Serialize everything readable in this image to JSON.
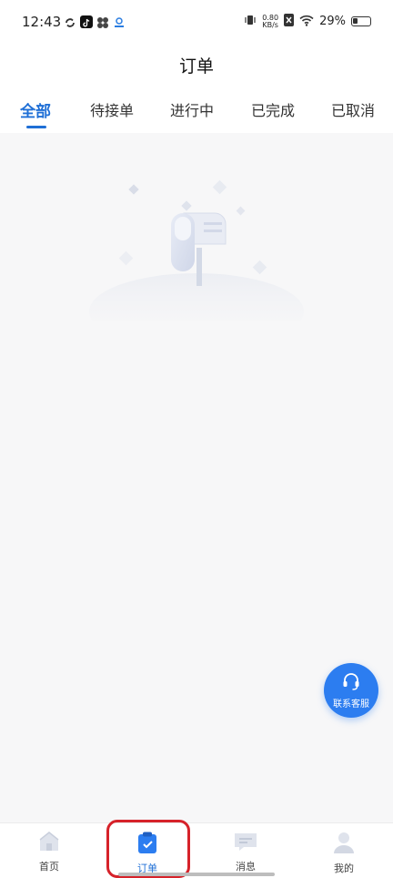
{
  "status_bar": {
    "time": "12:43",
    "net_speed_value": "0.80",
    "net_speed_unit": "KB/s",
    "battery_percent": "29%"
  },
  "header": {
    "title": "订单"
  },
  "tabs": [
    {
      "label": "全部",
      "active": true
    },
    {
      "label": "待接单",
      "active": false
    },
    {
      "label": "进行中",
      "active": false
    },
    {
      "label": "已完成",
      "active": false
    },
    {
      "label": "已取消",
      "active": false
    }
  ],
  "fab": {
    "label": "联系客服",
    "icon": "headset-icon"
  },
  "bottom_nav": [
    {
      "label": "首页",
      "icon": "home-icon",
      "active": false
    },
    {
      "label": "订单",
      "icon": "clipboard-icon",
      "active": true
    },
    {
      "label": "消息",
      "icon": "message-icon",
      "active": false
    },
    {
      "label": "我的",
      "icon": "user-icon",
      "active": false
    }
  ],
  "colors": {
    "accent": "#1f6fd6",
    "fab": "#2c7df0",
    "highlight": "#d6222a",
    "background": "#f7f7f8"
  }
}
